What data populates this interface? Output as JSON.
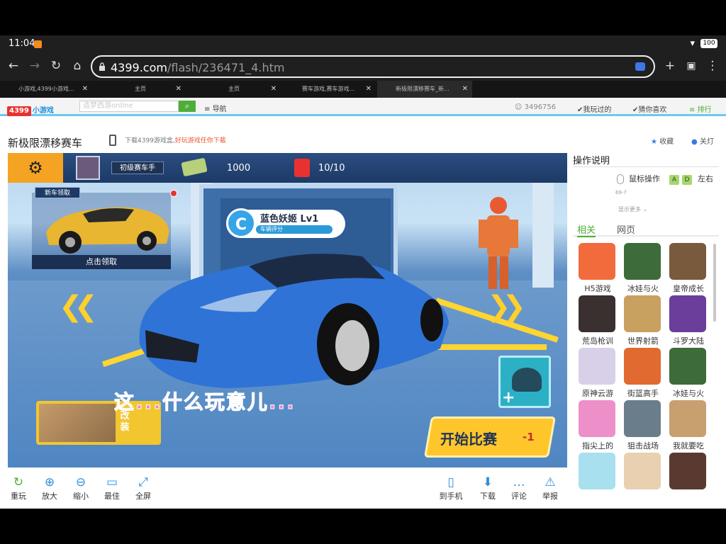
{
  "status": {
    "time": "11:04",
    "battery": "100"
  },
  "browser": {
    "url_host": "4399.com",
    "url_path": "/flash/236471_4.htm",
    "tabs": [
      {
        "label": "小游戏,4399小游戏...",
        "active": false
      },
      {
        "label": "主页",
        "active": false
      },
      {
        "label": "主页",
        "active": false
      },
      {
        "label": "赛车游戏,赛车游戏...",
        "active": false
      },
      {
        "label": "新极限漂移赛车_新...",
        "active": true
      }
    ]
  },
  "site": {
    "logo_badge": "4399",
    "logo_text": "小游戏",
    "search_placeholder": "造梦西游online",
    "nav_label": "导航",
    "user_id": "3496756",
    "played_label": "我玩过的",
    "likes_label": "猜你喜欢",
    "rank_label": "排行"
  },
  "game_page": {
    "title": "新极限漂移赛车",
    "promo_text": "下载4399游戏盒,",
    "promo_highlight": "好玩游戏任你下载",
    "fav_label": "收藏",
    "lamp_label": "关灯"
  },
  "game": {
    "rank": "初级赛车手",
    "cash": "1000",
    "fuel": "10/10",
    "new_car_tag": "新车领取",
    "claim_label": "点击领取",
    "car_class": "C",
    "car_name": "蓝色妖姬 Lv1",
    "car_score": "车辆评分",
    "subtitle": "这...什么玩意儿...",
    "modify_label": "改装",
    "start_label": "开始比赛",
    "start_cost": "-1"
  },
  "controls": {
    "replay": "重玩",
    "zoom_in": "放大",
    "zoom_out": "缩小",
    "best": "最佳",
    "fullscreen": "全屏",
    "to_phone": "到手机",
    "download": "下载",
    "comment": "评论",
    "report": "举报"
  },
  "sidebar": {
    "instructions_title": "操作说明",
    "mouse_label": "鼠标操作",
    "key_a": "A",
    "key_d": "D",
    "leftright": "左右",
    "version": "69-7",
    "show_more": "显示更多",
    "tab_related": "相关",
    "tab_web": "网页",
    "games": [
      {
        "label": "H5游戏",
        "color": "#f26b3c"
      },
      {
        "label": "冰娃与火",
        "color": "#3d6b3a"
      },
      {
        "label": "皇帝成长",
        "color": "#7a5a3d"
      },
      {
        "label": "荒岛枪训",
        "color": "#3a3030"
      },
      {
        "label": "世界射箭",
        "color": "#c8a060"
      },
      {
        "label": "斗罗大陆",
        "color": "#6a3e9a"
      },
      {
        "label": "原神云游",
        "color": "#d8d0e8"
      },
      {
        "label": "街篮高手",
        "color": "#e06a30"
      },
      {
        "label": "冰娃与火",
        "color": "#3d6b3a"
      },
      {
        "label": "指尖上的",
        "color": "#ed8fc8"
      },
      {
        "label": "狙击战场",
        "color": "#6a7d8a"
      },
      {
        "label": "我就要吃",
        "color": "#c8a070"
      },
      {
        "label": "",
        "color": "#a8e0f0"
      },
      {
        "label": "",
        "color": "#e8d0b0"
      },
      {
        "label": "",
        "color": "#5a3a30"
      }
    ]
  }
}
